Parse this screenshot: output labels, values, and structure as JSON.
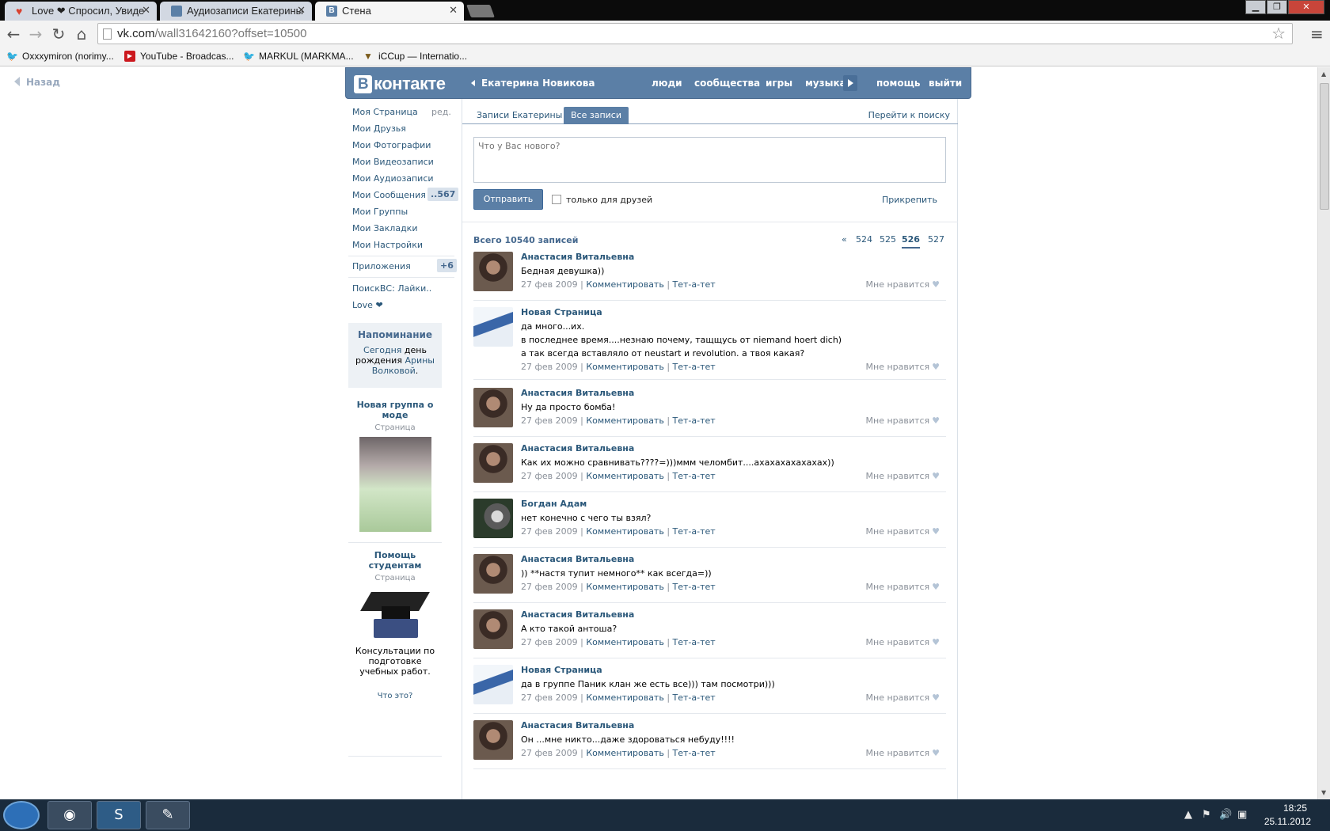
{
  "browser": {
    "tabs": [
      {
        "label": "Love ❤ Спросил, Увиде",
        "icon": "heart-favicon",
        "color": "#d9412f"
      },
      {
        "label": "Аудиозаписи Екатерины",
        "icon": "vk-favicon",
        "color": "#5b7fa6"
      },
      {
        "label": "Стена",
        "icon": "vk-favicon",
        "color": "#5b7fa6"
      }
    ],
    "url_host": "vk.com",
    "url_path": "/wall31642160?offset=10500",
    "bookmarks": [
      {
        "label": "Oxxxymiron (norimy...",
        "icon": "twitter-icon"
      },
      {
        "label": "YouTube - Broadcas...",
        "icon": "youtube-icon"
      },
      {
        "label": "MARKUL (MARKMA...",
        "icon": "twitter-icon"
      },
      {
        "label": "iCCup — Internatio...",
        "icon": "iccup-icon"
      }
    ]
  },
  "page": {
    "back_label": "Назад"
  },
  "vk": {
    "logo": "контакте",
    "logo_letter": "В",
    "user": "Екатерина Новикова",
    "nav": [
      "люди",
      "сообщества",
      "игры",
      "музыка",
      "помощь",
      "выйти"
    ],
    "accent": "#5b7fa6"
  },
  "sidebar": {
    "edit": "ред.",
    "items": [
      "Моя Страница",
      "Мои Друзья",
      "Мои Фотографии",
      "Мои Видеозаписи",
      "Мои Аудиозаписи",
      "Мои Сообщения",
      "Мои Группы",
      "Мои Закладки",
      "Мои Настройки"
    ],
    "messages_badge": "..567",
    "apps_label": "Приложения",
    "apps_badge": "+6",
    "app_links": [
      "ПоискВС: Лайки..",
      "Love ❤"
    ],
    "reminder": {
      "title": "Напоминание",
      "pre": "Сегодня",
      "mid": " день рождения ",
      "name": "Арины Волковой",
      "post": "."
    },
    "ad1": {
      "title": "Новая группа о моде",
      "type": "Страница"
    },
    "ad2": {
      "title": "Помощь студентам",
      "type": "Страница",
      "desc": "Консультации по подготовке учебных работ."
    },
    "what_is": "Что это?"
  },
  "wall": {
    "tab_own": "Записи Екатерины",
    "tab_all": "Все записи",
    "search_link": "Перейти к поиску",
    "placeholder": "Что у Вас нового?",
    "send": "Отправить",
    "friends_only": "только для друзей",
    "attach": "Прикрепить",
    "total": "Всего 10540 записей",
    "pages": [
      "«",
      "524",
      "525",
      "526",
      "527"
    ],
    "current_page": "526",
    "comment_label": "Комментировать",
    "tete_label": "Тет-а-тет",
    "like_label": "Мне нравится",
    "posts": [
      {
        "author": "Анастасия Витальевна",
        "lines": [
          "Бедная девушка))"
        ],
        "date": "27 фев 2009",
        "avatar": "girl"
      },
      {
        "author": "Новая Страница",
        "lines": [
          "да много...их.",
          "в последнее время....незнаю почему, тащщусь от niemand hoert dich)",
          "а так всегда вставляло от neustart и revolution. а твоя какая?"
        ],
        "date": "27 фев 2009",
        "avatar": "blue"
      },
      {
        "author": "Анастасия Витальевна",
        "lines": [
          "Ну да просто бомба!"
        ],
        "date": "27 фев 2009",
        "avatar": "girl"
      },
      {
        "author": "Анастасия Витальевна",
        "lines": [
          "Как их можно сравнивать????=)))ммм челомбит....ахахахахахахах))"
        ],
        "date": "27 фев 2009",
        "avatar": "girl"
      },
      {
        "author": "Богдан Адам",
        "lines": [
          "нет конечно с чего ты взял?"
        ],
        "date": "27 фев 2009",
        "avatar": "mixed"
      },
      {
        "author": "Анастасия Витальевна",
        "lines": [
          ")) **настя тупит немного** как всегда=))"
        ],
        "date": "27 фев 2009",
        "avatar": "girl"
      },
      {
        "author": "Анастасия Витальевна",
        "lines": [
          "А кто такой антоша?"
        ],
        "date": "27 фев 2009",
        "avatar": "girl"
      },
      {
        "author": "Новая Страница",
        "lines": [
          "да в группе Паник клан же есть все))) там посмотри)))"
        ],
        "date": "27 фев 2009",
        "avatar": "blue"
      },
      {
        "author": "Анастасия Витальевна",
        "lines": [
          "Он ...мне никто...даже здороваться небуду!!!!"
        ],
        "date": "27 фев 2009",
        "avatar": "girl"
      }
    ]
  },
  "taskbar": {
    "apps": [
      "chrome-icon",
      "skype-icon",
      "paint-icon"
    ],
    "time": "18:25",
    "date": "25.11.2012"
  }
}
